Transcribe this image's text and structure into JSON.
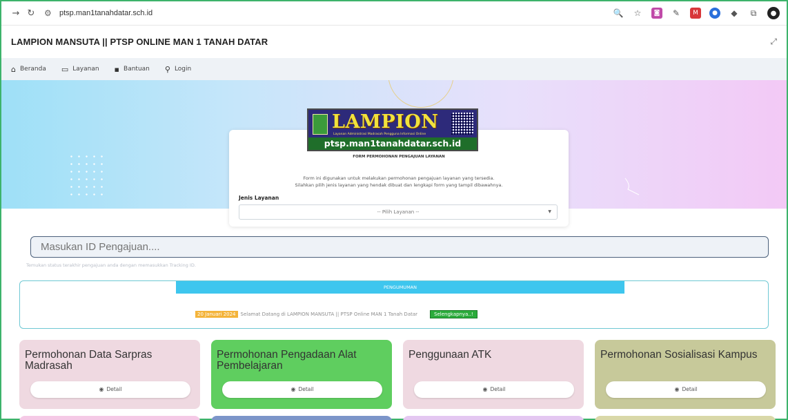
{
  "browser": {
    "url": "ptsp.man1tanahdatar.sch.id",
    "icons": [
      "back-icon",
      "reload-icon",
      "site-info-icon",
      "zoom-icon",
      "bookmark-star-icon",
      "extension-icon",
      "extensions-puzzle-icon",
      "profile-avatar-icon"
    ]
  },
  "site": {
    "title": "LAMPION MANSUTA || PTSP ONLINE MAN 1 TANAH DATAR"
  },
  "nav": {
    "items": [
      {
        "label": "Beranda",
        "icon": "home-icon"
      },
      {
        "label": "Layanan",
        "icon": "laptop-icon"
      },
      {
        "label": "Bantuan",
        "icon": "help-icon"
      },
      {
        "label": "Login",
        "icon": "user-icon"
      }
    ]
  },
  "logo": {
    "word": "LAMPION",
    "subtitle": "Layanan Administrasi Madrasah Pengguna Informasi Online",
    "url": "ptsp.man1tanahdatar.sch.id"
  },
  "form": {
    "title": "FORM PERMOHONAN PENGAJUAN LAYANAN",
    "desc_line1": "Form ini digunakan untuk melakukan permohonan pengajuan layanan yang tersedia.",
    "desc_line2": "Silahkan pilih jenis layanan yang hendak dibuat dan lengkapi form yang tampil dibawahnya.",
    "field_label": "Jenis Layanan",
    "select_value": "-- Pilih Layanan --"
  },
  "search": {
    "placeholder": "Masukan ID Pengajuan....",
    "help": "Temukan status terakhir pengajuan anda dengan memasukkan Tracking ID."
  },
  "announcement": {
    "header": "PENGUMUMAN",
    "date": "20 Januari 2024",
    "text": "Selamat Datang di LAMPION MANSUTA || PTSP Online MAN 1 Tanah Datar",
    "more": "Selengkapnya..!"
  },
  "services": [
    {
      "title": "Permohonan Data Sarpras Madrasah",
      "color": "#efd9e1",
      "detail": "Detail"
    },
    {
      "title": "Permohonan Pengadaan Alat Pembelajaran",
      "color": "#5fce5f",
      "detail": "Detail"
    },
    {
      "title": "Penggunaan ATK",
      "color": "#efd9e1",
      "detail": "Detail"
    },
    {
      "title": "Permohonan Sosialisasi Kampus",
      "color": "#c7c99a",
      "detail": "Detail"
    }
  ],
  "next_row_colors": [
    "#f5c9e6",
    "#7c95c9",
    "#e4c7f1",
    "#d9d8a8"
  ],
  "colors": {
    "accent_cyan": "#3ec6ee",
    "date_badge": "#f4b43a",
    "more_badge": "#2bab3b"
  }
}
